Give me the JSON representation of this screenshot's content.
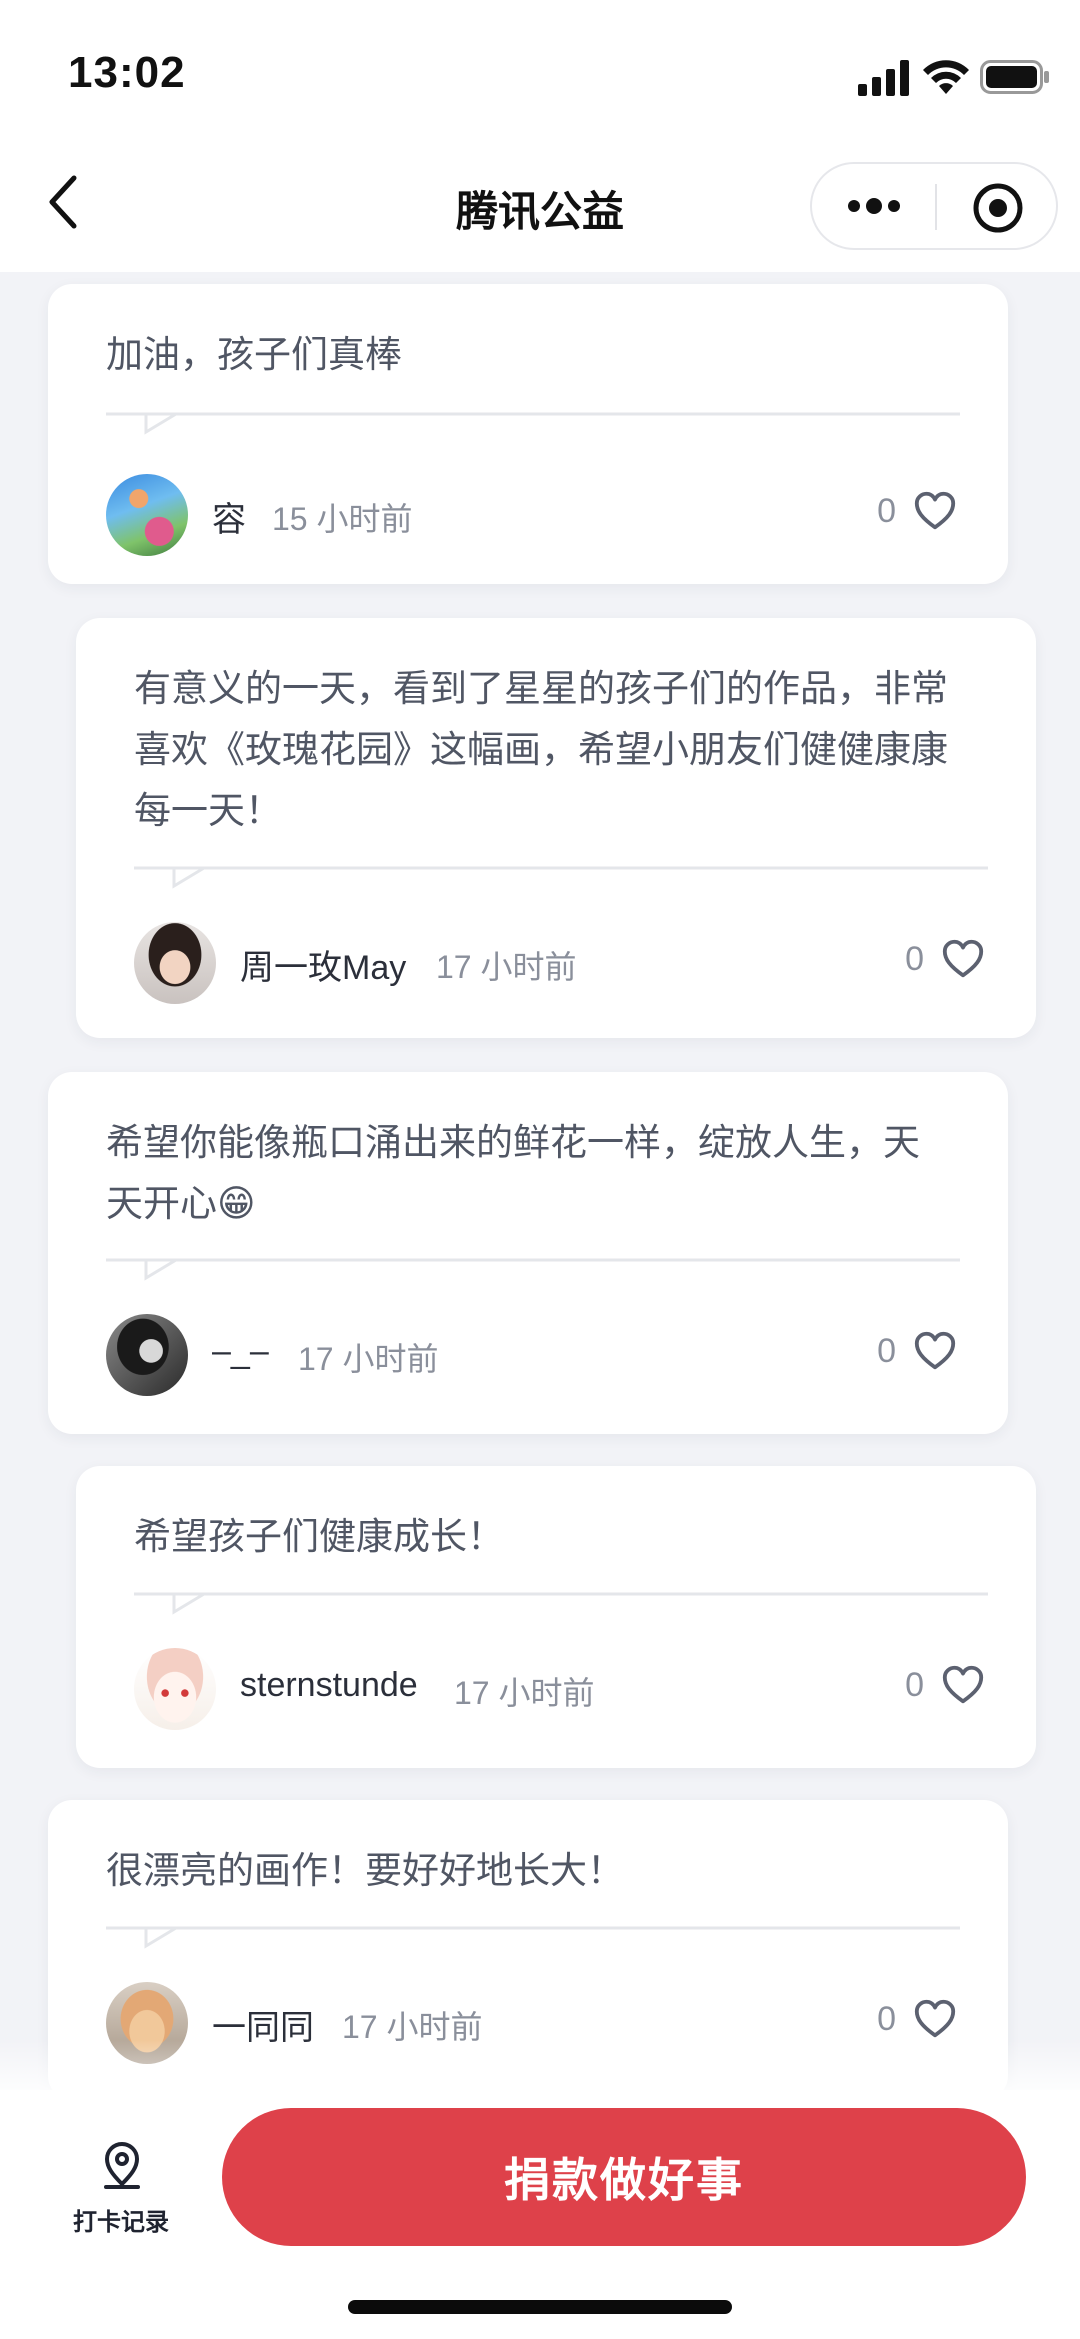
{
  "status_bar": {
    "time": "13:02"
  },
  "nav": {
    "title": "腾讯公益"
  },
  "comments": [
    {
      "text": "加油，孩子们真棒",
      "author": "容",
      "time_ago": "15 小时前",
      "likes": "0"
    },
    {
      "text": "有意义的一天，看到了星星的孩子们的作品，非常喜欢《玫瑰花园》这幅画，希望小朋友们健健康康每一天！",
      "author": "周一玫May",
      "time_ago": "17 小时前",
      "likes": "0"
    },
    {
      "text": "希望你能像瓶口涌出来的鲜花一样，绽放人生，天天开心😁",
      "author": "–_–",
      "time_ago": "17 小时前",
      "likes": "0"
    },
    {
      "text": "希望孩子们健康成长！",
      "author": "sternstunde",
      "time_ago": "17 小时前",
      "likes": "0"
    },
    {
      "text": "很漂亮的画作！要好好地长大！",
      "author": "一同同",
      "time_ago": "17 小时前",
      "likes": "0"
    }
  ],
  "bottom_bar": {
    "checkin_label": "打卡记录",
    "donate_label": "捐款做好事"
  },
  "colors": {
    "accent": "#de414a",
    "background": "#f2f3f7"
  }
}
